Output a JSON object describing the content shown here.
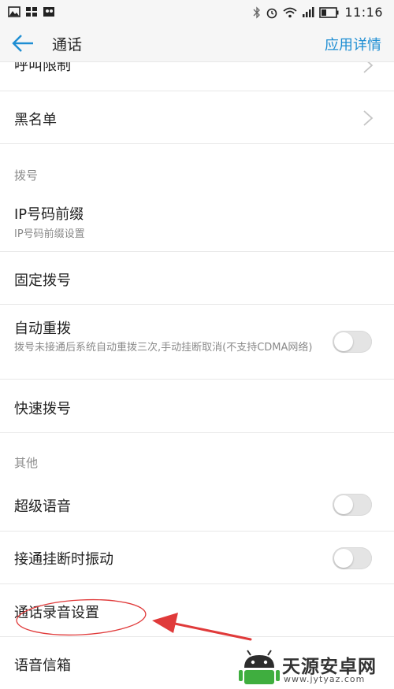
{
  "status_bar": {
    "time": "11:16",
    "icons": [
      "image-icon",
      "grid-icon",
      "bird-icon",
      "bluetooth-icon",
      "alarm-icon",
      "wifi-icon",
      "signal-icon",
      "battery-icon"
    ]
  },
  "app_bar": {
    "title": "通话",
    "detail_link": "应用详情",
    "accent": "#1e8ed3"
  },
  "rows": {
    "call_restrict": {
      "title": "呼叫限制"
    },
    "blacklist": {
      "title": "黑名单"
    },
    "section_dial": "拨号",
    "ip_prefix": {
      "title": "IP号码前缀",
      "subtitle": "IP号码前缀设置"
    },
    "fixed_dial": {
      "title": "固定拨号"
    },
    "auto_redial": {
      "title": "自动重拨",
      "subtitle": "拨号未接通后系统自动重拨三次,手动挂断取消(不支持CDMA网络)",
      "enabled": false
    },
    "speed_dial": {
      "title": "快速拨号"
    },
    "section_other": "其他",
    "super_voice": {
      "title": "超级语音",
      "enabled": false
    },
    "vibrate_on_connect": {
      "title": "接通挂断时振动",
      "enabled": false
    },
    "call_record": {
      "title": "通话录音设置"
    },
    "voicemail": {
      "title": "语音信箱"
    }
  },
  "annotation": {
    "color": "#e03a3a"
  },
  "watermark": {
    "name": "天源安卓网",
    "url": "www.jytyaz.com"
  }
}
